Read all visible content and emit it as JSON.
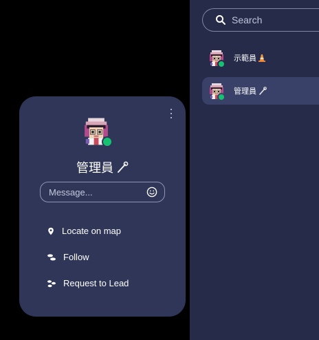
{
  "search": {
    "placeholder": "Search",
    "icon": "search-icon"
  },
  "users": [
    {
      "name": "示範員",
      "badge_icon": "traffic-cone-icon",
      "status": "online"
    },
    {
      "name": "管理員",
      "badge_icon": "wrench-icon",
      "status": "online",
      "selected": true
    }
  ],
  "card": {
    "name": "管理員",
    "name_icon": "wrench-icon",
    "status": "online",
    "message_placeholder": "Message...",
    "actions": [
      {
        "label": "Locate on map",
        "icon": "map-pin-icon"
      },
      {
        "label": "Follow",
        "icon": "footsteps-icon"
      },
      {
        "label": "Request to Lead",
        "icon": "lead-icon"
      }
    ]
  },
  "colors": {
    "background": "#000000",
    "panel": "#262B4A",
    "card": "#2F3658",
    "selected_row": "#3A4168",
    "online": "#16C172"
  }
}
